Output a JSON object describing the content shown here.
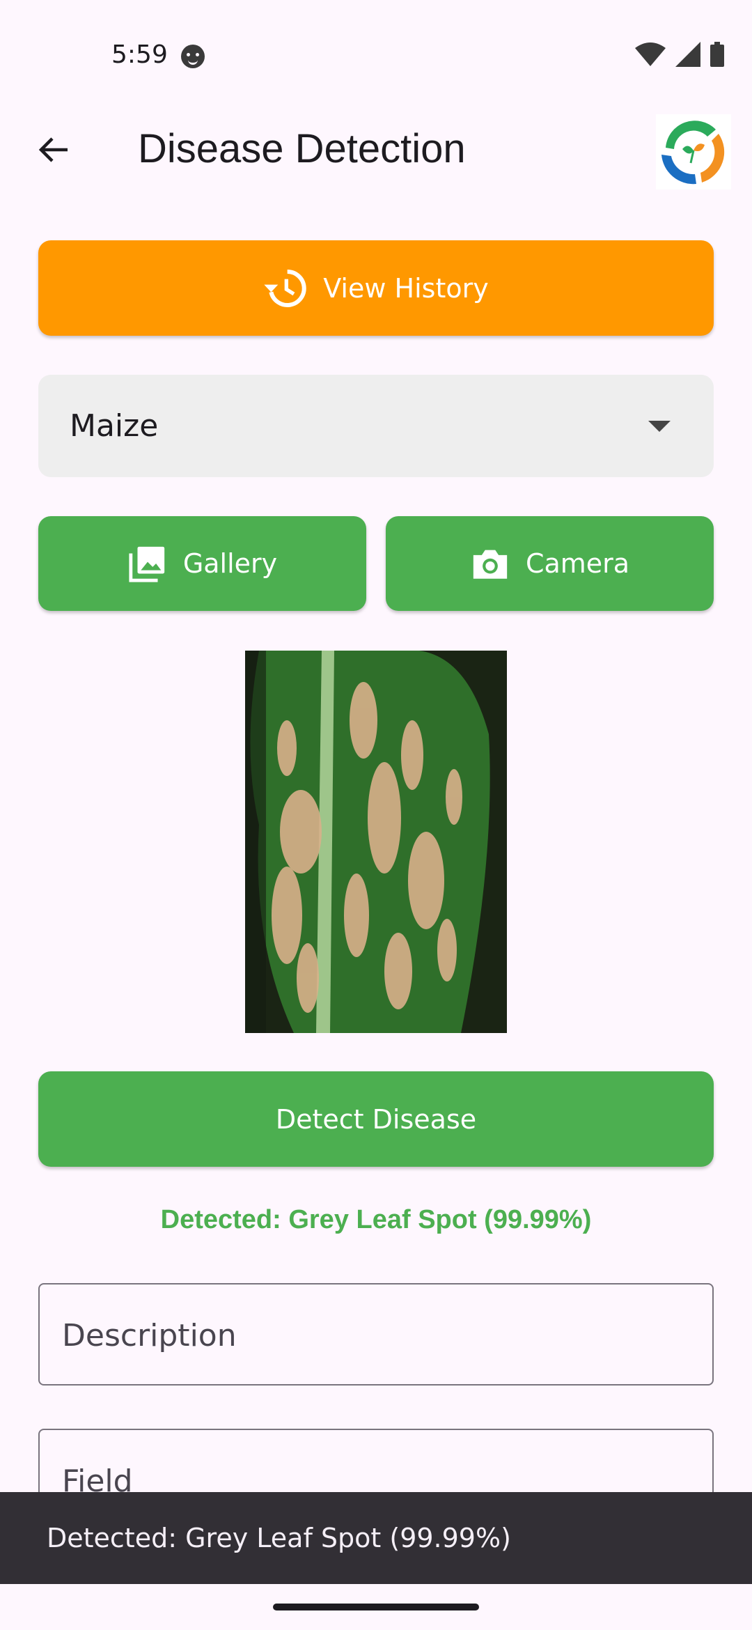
{
  "status_bar": {
    "time": "5:59"
  },
  "app_bar": {
    "title": "Disease Detection"
  },
  "history_button": {
    "label": "View History"
  },
  "crop_select": {
    "value": "Maize"
  },
  "gallery_button": {
    "label": "Gallery"
  },
  "camera_button": {
    "label": "Camera"
  },
  "detect_button": {
    "label": "Detect Disease"
  },
  "result": {
    "text": "Detected: Grey Leaf Spot (99.99%)"
  },
  "form": {
    "description_label": "Description",
    "field_label": "Field"
  },
  "snackbar": {
    "text": "Detected: Grey Leaf Spot (99.99%)"
  },
  "colors": {
    "accent_orange": "#FF9800",
    "accent_green": "#4CAF50",
    "background": "#FEF7FE"
  }
}
